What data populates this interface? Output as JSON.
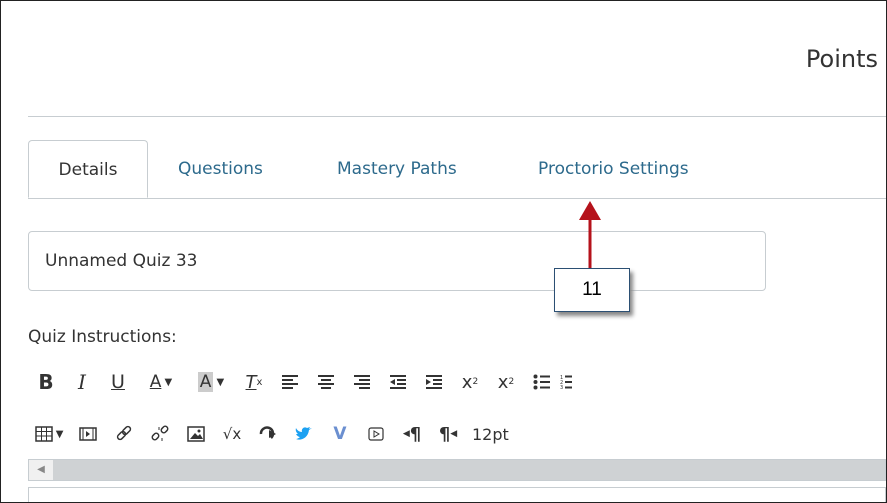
{
  "header": {
    "points_label": "Points"
  },
  "tabs": [
    "Details",
    "Questions",
    "Mastery Paths",
    "Proctorio Settings"
  ],
  "quiz": {
    "title_value": "Unnamed Quiz 33",
    "instructions_label": "Quiz Instructions:"
  },
  "callout": {
    "number": "11",
    "color": "#b5121b"
  },
  "toolbar": {
    "row1": [
      "bold-icon",
      "italic-icon",
      "underline-icon",
      "font-color-icon",
      "background-color-icon",
      "clear-formatting-icon",
      "align-left-icon",
      "align-center-icon",
      "align-right-icon",
      "outdent-icon",
      "indent-icon",
      "superscript-icon",
      "subscript-icon",
      "bullet-list-icon",
      "numbered-list-icon"
    ],
    "row2": [
      "table-icon",
      "media-icon",
      "link-icon",
      "unlink-icon",
      "image-icon",
      "equation-icon",
      "embed-icon",
      "twitter-icon",
      "vimeo-icon",
      "video-icon",
      "ltr-icon",
      "rtl-icon"
    ],
    "font_size": "12pt"
  }
}
